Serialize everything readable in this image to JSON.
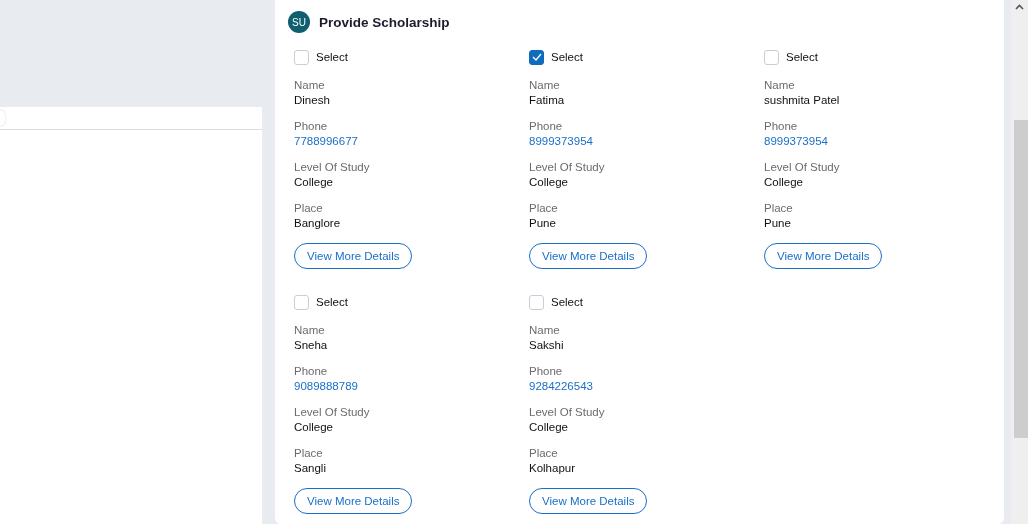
{
  "panel": {
    "avatar": "SU",
    "title": "Provide Scholarship"
  },
  "students": [
    {
      "select_label": "Select",
      "selected": false,
      "fields": [
        {
          "label": "Name",
          "value": "Dinesh",
          "kind": "text"
        },
        {
          "label": "Phone",
          "value": "7788996677",
          "kind": "link"
        },
        {
          "label": "Level Of Study",
          "value": "College",
          "kind": "text"
        },
        {
          "label": "Place",
          "value": "Banglore",
          "kind": "text"
        }
      ],
      "button": "View More Details"
    },
    {
      "select_label": "Select",
      "selected": true,
      "fields": [
        {
          "label": "Name",
          "value": "Fatima",
          "kind": "text"
        },
        {
          "label": "Phone",
          "value": "8999373954",
          "kind": "link"
        },
        {
          "label": "Level Of Study",
          "value": "College",
          "kind": "text"
        },
        {
          "label": "Place",
          "value": "Pune",
          "kind": "text"
        }
      ],
      "button": "View More Details"
    },
    {
      "select_label": "Select",
      "selected": false,
      "fields": [
        {
          "label": "Name",
          "value": "sushmita Patel",
          "kind": "text"
        },
        {
          "label": "Phone",
          "value": "8999373954",
          "kind": "link"
        },
        {
          "label": "Level Of Study",
          "value": "College",
          "kind": "text"
        },
        {
          "label": "Place",
          "value": "Pune",
          "kind": "text"
        }
      ],
      "button": "View More Details"
    },
    {
      "select_label": "Select",
      "selected": false,
      "fields": [
        {
          "label": "Name",
          "value": "Sneha",
          "kind": "text"
        },
        {
          "label": "Phone",
          "value": "9089888789",
          "kind": "link"
        },
        {
          "label": "Level Of Study",
          "value": "College",
          "kind": "text"
        },
        {
          "label": "Place",
          "value": "Sangli",
          "kind": "text"
        }
      ],
      "button": "View More Details"
    },
    {
      "select_label": "Select",
      "selected": false,
      "fields": [
        {
          "label": "Name",
          "value": "Sakshi",
          "kind": "text"
        },
        {
          "label": "Phone",
          "value": "9284226543",
          "kind": "link"
        },
        {
          "label": "Level Of Study",
          "value": "College",
          "kind": "text"
        },
        {
          "label": "Place",
          "value": "Kolhapur",
          "kind": "text"
        }
      ],
      "button": "View More Details"
    }
  ]
}
